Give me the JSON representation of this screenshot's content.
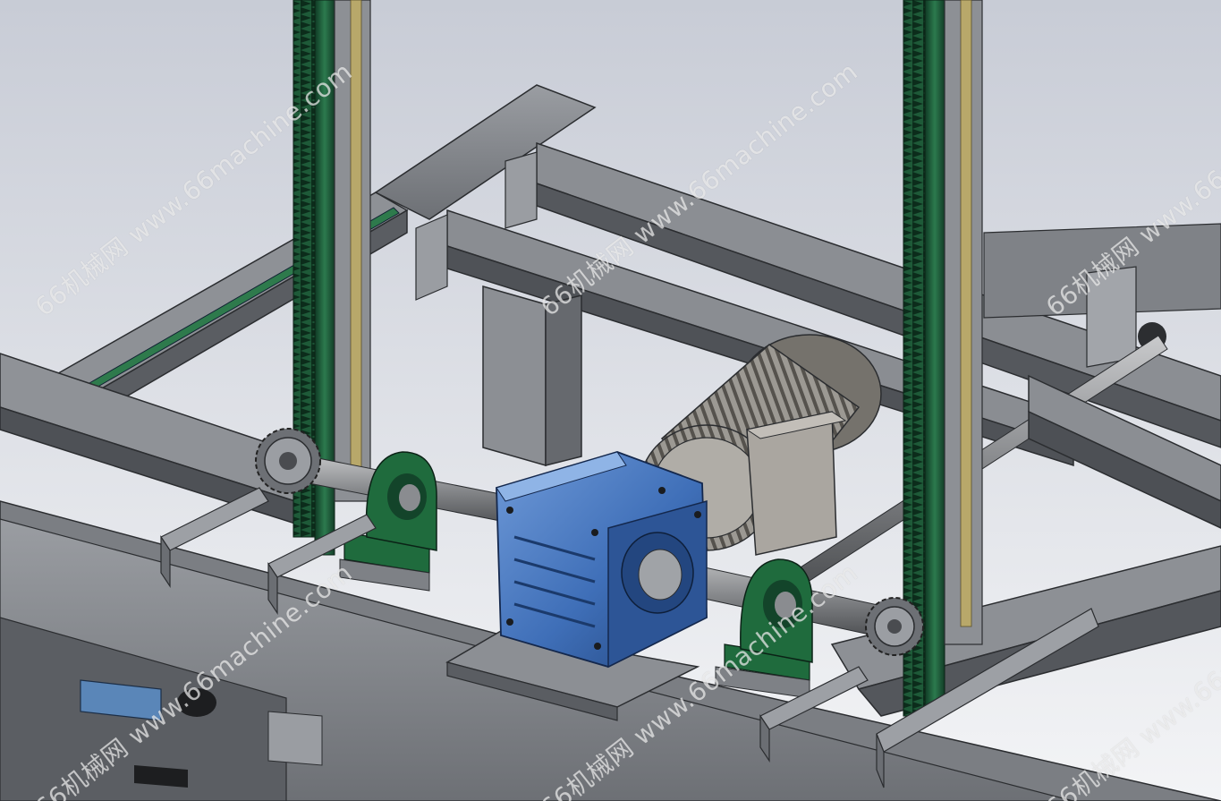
{
  "scene": {
    "subject": "CAD 3D render of a rack-and-pinion lifting mechanism driven by a blue worm gear reducer and motor",
    "colors": {
      "background_top": "#c9ced8",
      "background_bottom": "#f2f3f5",
      "frame_steel": "#7c7f84",
      "frame_dark": "#4f5256",
      "rack_green": "#1f5a3a",
      "reducer_blue": "#3f6fb8",
      "bearing_green": "#1f6b3d",
      "motor_grey": "#8a8781"
    }
  },
  "watermarks": [
    {
      "text": "66机械网 www.66machine.com"
    },
    {
      "text": "66机械网 www.66machine.com"
    },
    {
      "text": "66机械网 www.66machine.com"
    },
    {
      "text": "66机械网 www.66machine.com"
    },
    {
      "text": "66机械网 www.66machine.com"
    },
    {
      "text": "66机械网 www.66machine.com"
    }
  ]
}
